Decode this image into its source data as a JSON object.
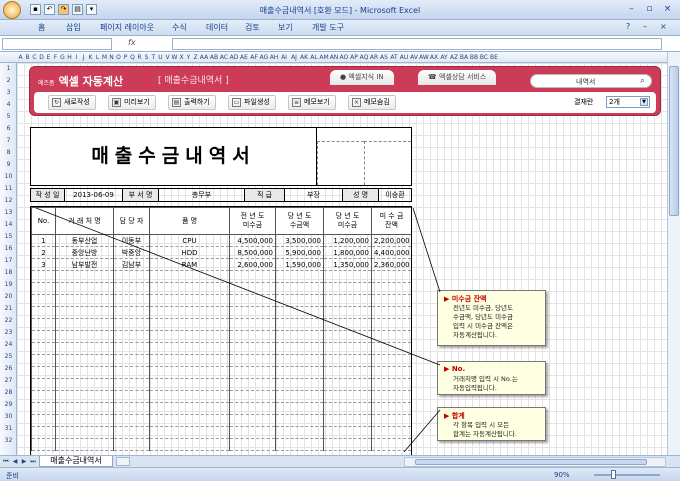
{
  "window": {
    "title": "매출수금내역서  [호환 모드]  - Microsoft Excel"
  },
  "ribbon": {
    "tabs": [
      "홈",
      "삽입",
      "페이지 레이아웃",
      "수식",
      "데이터",
      "검토",
      "보기",
      "개발 도구"
    ]
  },
  "formula": {
    "fx": "fx",
    "name_box": "",
    "value": ""
  },
  "columns": [
    "A",
    "B",
    "C",
    "D",
    "E",
    "F",
    "G",
    "H",
    "I",
    "J",
    "K",
    "L",
    "M",
    "N",
    "O",
    "P",
    "Q",
    "R",
    "S",
    "T",
    "U",
    "V",
    "W",
    "X",
    "Y",
    "Z",
    "AA",
    "AB",
    "AC",
    "AD",
    "AE",
    "AF",
    "AG",
    "AH",
    "AI",
    "AJ",
    "AK",
    "AL",
    "AM",
    "AN",
    "AO",
    "AP",
    "AQ",
    "AR",
    "AS",
    "AT",
    "AU",
    "AV",
    "AW",
    "AX",
    "AY",
    "AZ",
    "BA",
    "BB",
    "BC",
    "BE"
  ],
  "rows": [
    "1",
    "2",
    "3",
    "4",
    "5",
    "6",
    "7",
    "8",
    "9",
    "10",
    "11",
    "12",
    "13",
    "14",
    "15",
    "16",
    "17",
    "18",
    "19",
    "20",
    "21",
    "22",
    "23",
    "24",
    "25",
    "26",
    "27",
    "28",
    "29",
    "30",
    "31",
    "32"
  ],
  "banner": {
    "brand_small": "에즈폼",
    "brand": "엑셀 자동계산",
    "section": "[ 매출수금내역서 ]",
    "links": [
      "엑셀지식 IN",
      "엑셀상담 서비스"
    ],
    "search_value": "내역서",
    "buttons": [
      "새로작성",
      "미리보기",
      "출력하기",
      "파일생성",
      "메모보기",
      "메모숨김"
    ],
    "approval_label": "결재란",
    "approval_value": "2개"
  },
  "doc": {
    "title": "매출수금내역서"
  },
  "info": {
    "date_label": "작 성 일",
    "date": "2013-06-09",
    "dept_label": "부 서 명",
    "dept": "총무부",
    "rank_label": "직 급",
    "rank": "부장",
    "name_label": "성 명",
    "name": "이승환"
  },
  "table": {
    "headers": [
      "No.",
      "거 래 처 명",
      "담 당 자",
      "품    명",
      "전 년 도\n미수금",
      "당 년 도\n수금액",
      "당 년 도\n미수금",
      "미 수 금\n잔액"
    ],
    "rows": [
      [
        "1",
        "동부산업",
        "이동부",
        "CPU",
        "4,500,000",
        "3,500,000",
        "1,200,000",
        "2,200,000"
      ],
      [
        "2",
        "중앙난방",
        "박중앙",
        "HDD",
        "8,500,000",
        "5,900,000",
        "1,800,000",
        "4,400,000"
      ],
      [
        "3",
        "남부발전",
        "김남부",
        "RAM",
        "2,600,000",
        "1,590,000",
        "1,350,000",
        "2,360,000"
      ]
    ],
    "empty_rows": 15
  },
  "notes": [
    {
      "title": "미수금 잔액",
      "body": "전년도 미수금, 당년도\n수금액, 당년도 미수금\n입력 시 미수금 잔액은\n자동계산됩니다."
    },
    {
      "title": "No.",
      "body": "거래처명 입력 시 No.는\n자동입력됩니다."
    },
    {
      "title": "합계",
      "body": "각 항목 입력 시 모든\n합계는 자동계산됩니다."
    }
  ],
  "sheet": {
    "tab": "매출수금내역서"
  },
  "status": {
    "ready": "준비",
    "zoom": "90%"
  }
}
